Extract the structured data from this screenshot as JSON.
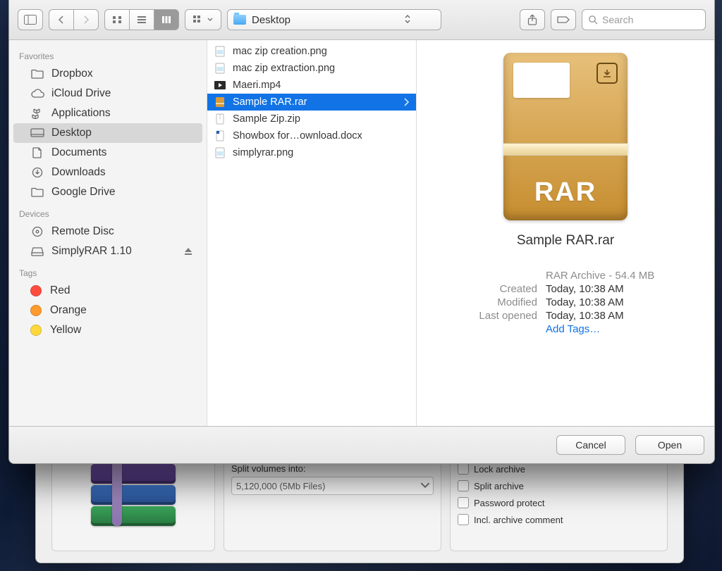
{
  "toolbar": {
    "path_label": "Desktop",
    "search_placeholder": "Search"
  },
  "sidebar": {
    "sections": [
      {
        "header": "Favorites",
        "items": [
          {
            "label": "Dropbox",
            "icon": "folder"
          },
          {
            "label": "iCloud Drive",
            "icon": "cloud"
          },
          {
            "label": "Applications",
            "icon": "apps"
          },
          {
            "label": "Desktop",
            "icon": "desktop",
            "selected": true
          },
          {
            "label": "Documents",
            "icon": "doc"
          },
          {
            "label": "Downloads",
            "icon": "download"
          },
          {
            "label": "Google Drive",
            "icon": "folder"
          }
        ]
      },
      {
        "header": "Devices",
        "items": [
          {
            "label": "Remote Disc",
            "icon": "disc"
          },
          {
            "label": "SimplyRAR 1.10",
            "icon": "drive",
            "eject": true
          }
        ]
      },
      {
        "header": "Tags",
        "items": [
          {
            "label": "Red",
            "tag": "#ff4c3f"
          },
          {
            "label": "Orange",
            "tag": "#ff9a2d"
          },
          {
            "label": "Yellow",
            "tag": "#ffd93b"
          }
        ]
      }
    ]
  },
  "files": [
    {
      "name": "mac zip creation.png",
      "kind": "png"
    },
    {
      "name": "mac zip extraction.png",
      "kind": "png"
    },
    {
      "name": "Maeri.mp4",
      "kind": "mov"
    },
    {
      "name": "Sample RAR.rar",
      "kind": "rar",
      "selected": true
    },
    {
      "name": "Sample Zip.zip",
      "kind": "zip"
    },
    {
      "name": "Showbox for…ownload.docx",
      "kind": "docx"
    },
    {
      "name": "simplyrar.png",
      "kind": "png"
    }
  ],
  "preview": {
    "name": "Sample RAR.rar",
    "icon_text": "RAR",
    "type_line": "RAR Archive - 54.4 MB",
    "rows": [
      {
        "k": "Created",
        "v": "Today, 10:38 AM"
      },
      {
        "k": "Modified",
        "v": "Today, 10:38 AM"
      },
      {
        "k": "Last opened",
        "v": "Today, 10:38 AM"
      }
    ],
    "add_tags": "Add Tags…"
  },
  "footer": {
    "cancel": "Cancel",
    "open": "Open"
  },
  "under": {
    "split_label": "Split volumes into:",
    "split_value": "5,120,000 (5Mb Files)",
    "checks": [
      "Lock archive",
      "Split archive",
      "Password protect",
      "Incl. archive comment"
    ]
  }
}
